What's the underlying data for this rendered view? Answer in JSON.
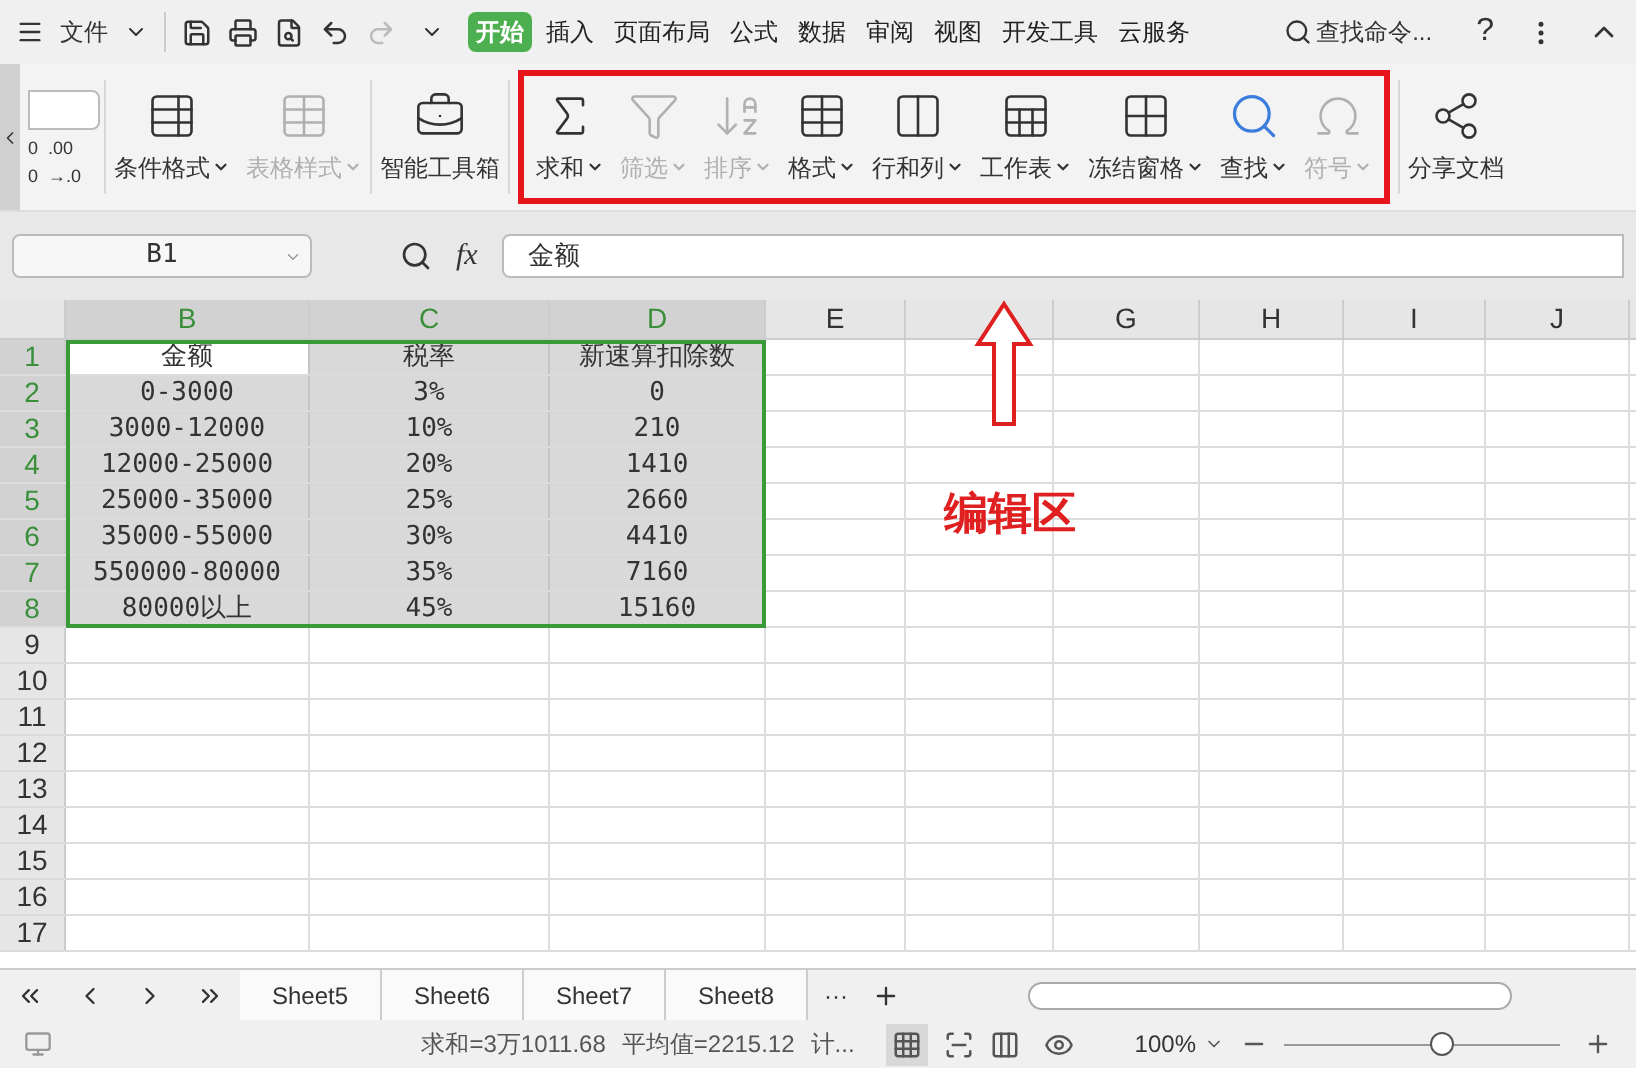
{
  "menu": {
    "label": "文件"
  },
  "tabs": [
    {
      "label": "开始",
      "selected": true
    },
    {
      "label": "插入",
      "selected": false
    },
    {
      "label": "页面布局",
      "selected": false
    },
    {
      "label": "公式",
      "selected": false
    },
    {
      "label": "数据",
      "selected": false
    },
    {
      "label": "审阅",
      "selected": false
    },
    {
      "label": "视图",
      "selected": false
    },
    {
      "label": "开发工具",
      "selected": false
    },
    {
      "label": "云服务",
      "selected": false
    }
  ],
  "command_search": {
    "placeholder": "查找命令..."
  },
  "help": "?",
  "ribbon_left": {
    "decimal_lines": [
      "0  .00",
      "0  →.0"
    ]
  },
  "ribbon": [
    {
      "kind": "cond",
      "label": "条件格式",
      "disabled": false,
      "dropdown": true
    },
    {
      "kind": "tablestyle",
      "label": "表格样式",
      "disabled": true,
      "dropdown": true
    },
    {
      "kind": "toolbox",
      "label": "智能工具箱",
      "disabled": false,
      "dropdown": false
    },
    {
      "kind": "sum",
      "label": "求和",
      "disabled": false,
      "dropdown": true
    },
    {
      "kind": "filter",
      "label": "筛选",
      "disabled": true,
      "dropdown": true
    },
    {
      "kind": "sort",
      "label": "排序",
      "disabled": true,
      "dropdown": true
    },
    {
      "kind": "format",
      "label": "格式",
      "disabled": false,
      "dropdown": true
    },
    {
      "kind": "rowcol",
      "label": "行和列",
      "disabled": false,
      "dropdown": true
    },
    {
      "kind": "sheet",
      "label": "工作表",
      "disabled": false,
      "dropdown": true
    },
    {
      "kind": "freeze",
      "label": "冻结窗格",
      "disabled": false,
      "dropdown": true
    },
    {
      "kind": "find",
      "label": "查找",
      "disabled": false,
      "dropdown": true
    },
    {
      "kind": "symbol",
      "label": "符号",
      "disabled": true,
      "dropdown": true
    },
    {
      "kind": "share",
      "label": "分享文档",
      "disabled": false,
      "dropdown": false
    }
  ],
  "formula_bar": {
    "name_box": "B1",
    "fx": "fx",
    "value": "金额"
  },
  "columns": [
    {
      "label": "B",
      "selected": true
    },
    {
      "label": "C",
      "selected": true
    },
    {
      "label": "D",
      "selected": true
    },
    {
      "label": "E",
      "selected": false
    },
    {
      "selected": false
    },
    {
      "label": "G",
      "selected": false
    },
    {
      "label": "H",
      "selected": false
    },
    {
      "label": "I",
      "selected": false
    },
    {
      "label": "J",
      "selected": false
    }
  ],
  "rows": [
    {
      "label": "1",
      "selected": true,
      "cells": [
        "金额",
        "税率",
        "新速算扣除数"
      ]
    },
    {
      "label": "2",
      "selected": true,
      "cells": [
        "0-3000",
        "3%",
        "0"
      ]
    },
    {
      "label": "3",
      "selected": true,
      "cells": [
        "3000-12000",
        "10%",
        "210"
      ]
    },
    {
      "label": "4",
      "selected": true,
      "cells": [
        "12000-25000",
        "20%",
        "1410"
      ]
    },
    {
      "label": "5",
      "selected": true,
      "cells": [
        "25000-35000",
        "25%",
        "2660"
      ]
    },
    {
      "label": "6",
      "selected": true,
      "cells": [
        "35000-55000",
        "30%",
        "4410"
      ]
    },
    {
      "label": "7",
      "selected": true,
      "cells": [
        "550000-80000",
        "35%",
        "7160"
      ]
    },
    {
      "label": "8",
      "selected": true,
      "cells": [
        "80000以上",
        "45%",
        "15160"
      ]
    },
    {
      "label": "9",
      "selected": false,
      "cells": []
    },
    {
      "label": "10",
      "selected": false,
      "cells": []
    },
    {
      "label": "11",
      "selected": false,
      "cells": []
    },
    {
      "label": "12",
      "selected": false,
      "cells": []
    },
    {
      "label": "13",
      "selected": false,
      "cells": []
    },
    {
      "label": "14",
      "selected": false,
      "cells": []
    },
    {
      "label": "15",
      "selected": false,
      "cells": []
    },
    {
      "label": "16",
      "selected": false,
      "cells": []
    },
    {
      "label": "17",
      "selected": false,
      "cells": []
    }
  ],
  "annotation": {
    "label": "编辑区"
  },
  "sheet_tabs": [
    {
      "label": "Sheet5",
      "selected": false
    },
    {
      "label": "Sheet6",
      "selected": false
    },
    {
      "label": "Sheet7",
      "selected": false
    },
    {
      "label": "Sheet8",
      "selected": false
    }
  ],
  "sheet_more": "···",
  "status_bar": {
    "sum": "求和=3万1011.68",
    "average": "平均值=2215.12",
    "count": "计...",
    "zoom": "100%",
    "zoom_slider": {
      "level": 0.57
    }
  }
}
